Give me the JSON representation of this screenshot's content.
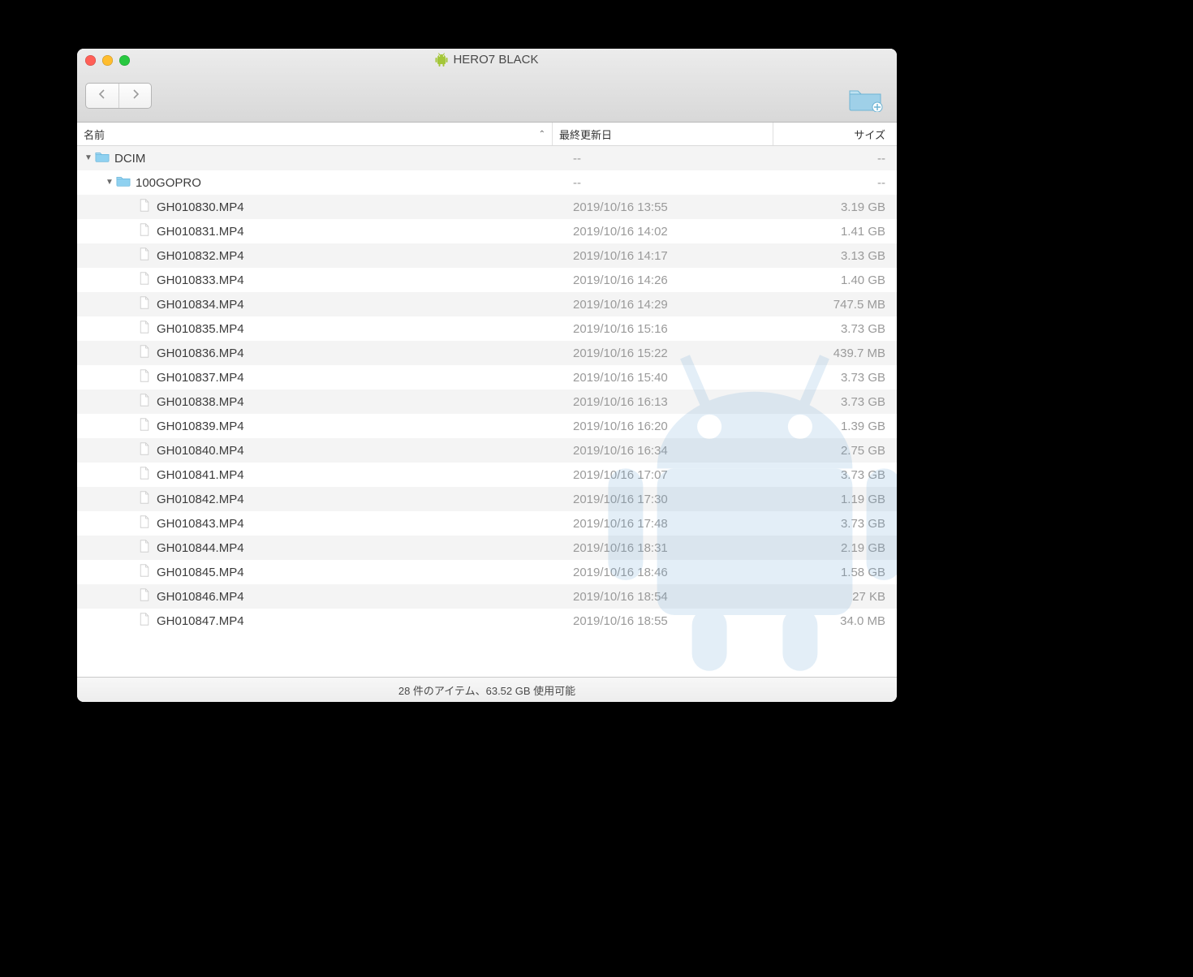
{
  "window": {
    "title": "HERO7 BLACK"
  },
  "columns": {
    "name": "名前",
    "date": "最終更新日",
    "size": "サイズ"
  },
  "rows": [
    {
      "indent": 0,
      "type": "folder",
      "expanded": true,
      "name": "DCIM",
      "date": "--",
      "size": "--"
    },
    {
      "indent": 1,
      "type": "folder",
      "expanded": true,
      "name": "100GOPRO",
      "date": "--",
      "size": "--"
    },
    {
      "indent": 2,
      "type": "file",
      "name": "GH010830.MP4",
      "date": "2019/10/16 13:55",
      "size": "3.19 GB"
    },
    {
      "indent": 2,
      "type": "file",
      "name": "GH010831.MP4",
      "date": "2019/10/16 14:02",
      "size": "1.41 GB"
    },
    {
      "indent": 2,
      "type": "file",
      "name": "GH010832.MP4",
      "date": "2019/10/16 14:17",
      "size": "3.13 GB"
    },
    {
      "indent": 2,
      "type": "file",
      "name": "GH010833.MP4",
      "date": "2019/10/16 14:26",
      "size": "1.40 GB"
    },
    {
      "indent": 2,
      "type": "file",
      "name": "GH010834.MP4",
      "date": "2019/10/16 14:29",
      "size": "747.5 MB"
    },
    {
      "indent": 2,
      "type": "file",
      "name": "GH010835.MP4",
      "date": "2019/10/16 15:16",
      "size": "3.73 GB"
    },
    {
      "indent": 2,
      "type": "file",
      "name": "GH010836.MP4",
      "date": "2019/10/16 15:22",
      "size": "439.7 MB"
    },
    {
      "indent": 2,
      "type": "file",
      "name": "GH010837.MP4",
      "date": "2019/10/16 15:40",
      "size": "3.73 GB"
    },
    {
      "indent": 2,
      "type": "file",
      "name": "GH010838.MP4",
      "date": "2019/10/16 16:13",
      "size": "3.73 GB"
    },
    {
      "indent": 2,
      "type": "file",
      "name": "GH010839.MP4",
      "date": "2019/10/16 16:20",
      "size": "1.39 GB"
    },
    {
      "indent": 2,
      "type": "file",
      "name": "GH010840.MP4",
      "date": "2019/10/16 16:34",
      "size": "2.75 GB"
    },
    {
      "indent": 2,
      "type": "file",
      "name": "GH010841.MP4",
      "date": "2019/10/16 17:07",
      "size": "3.73 GB"
    },
    {
      "indent": 2,
      "type": "file",
      "name": "GH010842.MP4",
      "date": "2019/10/16 17:30",
      "size": "1.19 GB"
    },
    {
      "indent": 2,
      "type": "file",
      "name": "GH010843.MP4",
      "date": "2019/10/16 17:48",
      "size": "3.73 GB"
    },
    {
      "indent": 2,
      "type": "file",
      "name": "GH010844.MP4",
      "date": "2019/10/16 18:31",
      "size": "2.19 GB"
    },
    {
      "indent": 2,
      "type": "file",
      "name": "GH010845.MP4",
      "date": "2019/10/16 18:46",
      "size": "1.58 GB"
    },
    {
      "indent": 2,
      "type": "file",
      "name": "GH010846.MP4",
      "date": "2019/10/16 18:54",
      "size": "27 KB"
    },
    {
      "indent": 2,
      "type": "file",
      "name": "GH010847.MP4",
      "date": "2019/10/16 18:55",
      "size": "34.0 MB"
    }
  ],
  "statusbar": {
    "text": "28 件のアイテム、63.52 GB 使用可能"
  }
}
